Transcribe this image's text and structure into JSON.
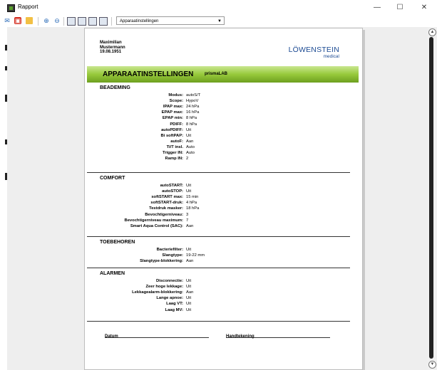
{
  "window": {
    "title": "Rapport",
    "buttons": {
      "minimize": "—",
      "maximize": "☐",
      "close": "✕"
    }
  },
  "toolbar": {
    "report_select": "Apparaatinstellingen"
  },
  "report": {
    "patient": {
      "first_name": "Maximilian",
      "last_name": "Mustermann",
      "dob": "19.08.1951"
    },
    "logo": {
      "main": "LÖWENSTEIN",
      "sub": "medical"
    },
    "title": "APPARAATINSTELLINGEN",
    "device": "prismaLAB",
    "sections": [
      {
        "title": "BEADEMING",
        "rows": [
          {
            "label": "Modus:",
            "value": "autoS/T"
          },
          {
            "label": "Scope:",
            "value": "HypoV"
          },
          {
            "label": "IPAP max:",
            "value": "24 hPa"
          },
          {
            "label": "EPAP max:",
            "value": "16 hPa"
          },
          {
            "label": "EPAP min:",
            "value": "8 hPa"
          },
          {
            "label": "PDIFF:",
            "value": "8 hPa"
          },
          {
            "label": "autoPDIFF:",
            "value": "Uit"
          },
          {
            "label": "Bi softPAP:",
            "value": "Uit"
          },
          {
            "label": "autoF:",
            "value": "Aan"
          },
          {
            "label": "Ti/T insl.",
            "value": "Auto"
          },
          {
            "label": "Trigger IN:",
            "value": "Auto"
          },
          {
            "label": "Ramp IN:",
            "value": "2"
          }
        ]
      },
      {
        "title": "COMFORT",
        "rows": [
          {
            "label": "autoSTART:",
            "value": "Uit"
          },
          {
            "label": "autoSTOP:",
            "value": "Uit"
          },
          {
            "label": "softSTART max:",
            "value": "15 min"
          },
          {
            "label": "softSTART-druk:",
            "value": "4 hPa"
          },
          {
            "label": "Testdruk masker:",
            "value": "18 hPa"
          },
          {
            "label": "Bevochtigerniveau:",
            "value": "3"
          },
          {
            "label": "Bevochtigerniveau maximum:",
            "value": "7"
          },
          {
            "label": "Smart Aqua Control (SAC):",
            "value": "Aan"
          }
        ]
      },
      {
        "title": "TOEBEHOREN",
        "rows": [
          {
            "label": "Bacteriefilter:",
            "value": "Uit"
          },
          {
            "label": "Slangtype:",
            "value": "19-22 mm"
          },
          {
            "label": "Slangtype-blokkering:",
            "value": "Aan"
          }
        ]
      },
      {
        "title": "ALARMEN",
        "rows": [
          {
            "label": "Disconnectie:",
            "value": "Uit"
          },
          {
            "label": "Zeer hoge lekkage:",
            "value": "Uit"
          },
          {
            "label": "Lekkagealarm-blokkering:",
            "value": "Aan"
          },
          {
            "label": "Lange apnoe:",
            "value": "Uit"
          },
          {
            "label": "Laag VT:",
            "value": "Uit"
          },
          {
            "label": "Laag MV:",
            "value": "Uit"
          }
        ]
      }
    ],
    "signature": {
      "date_label": "Datum",
      "sign_label": "Handtekening"
    }
  },
  "colors": {
    "banner_top": "#c9e690",
    "banner_bottom": "#6d9f1f",
    "logo_blue": "#1d4b93",
    "viewport_bg": "#eeeeee"
  },
  "icons": [
    "email-icon",
    "pdf-icon",
    "open-folder-icon",
    "zoom-in-icon",
    "zoom-out-icon",
    "page-single-icon",
    "page-two-icon",
    "page-multi-icon",
    "page-fit-icon"
  ]
}
